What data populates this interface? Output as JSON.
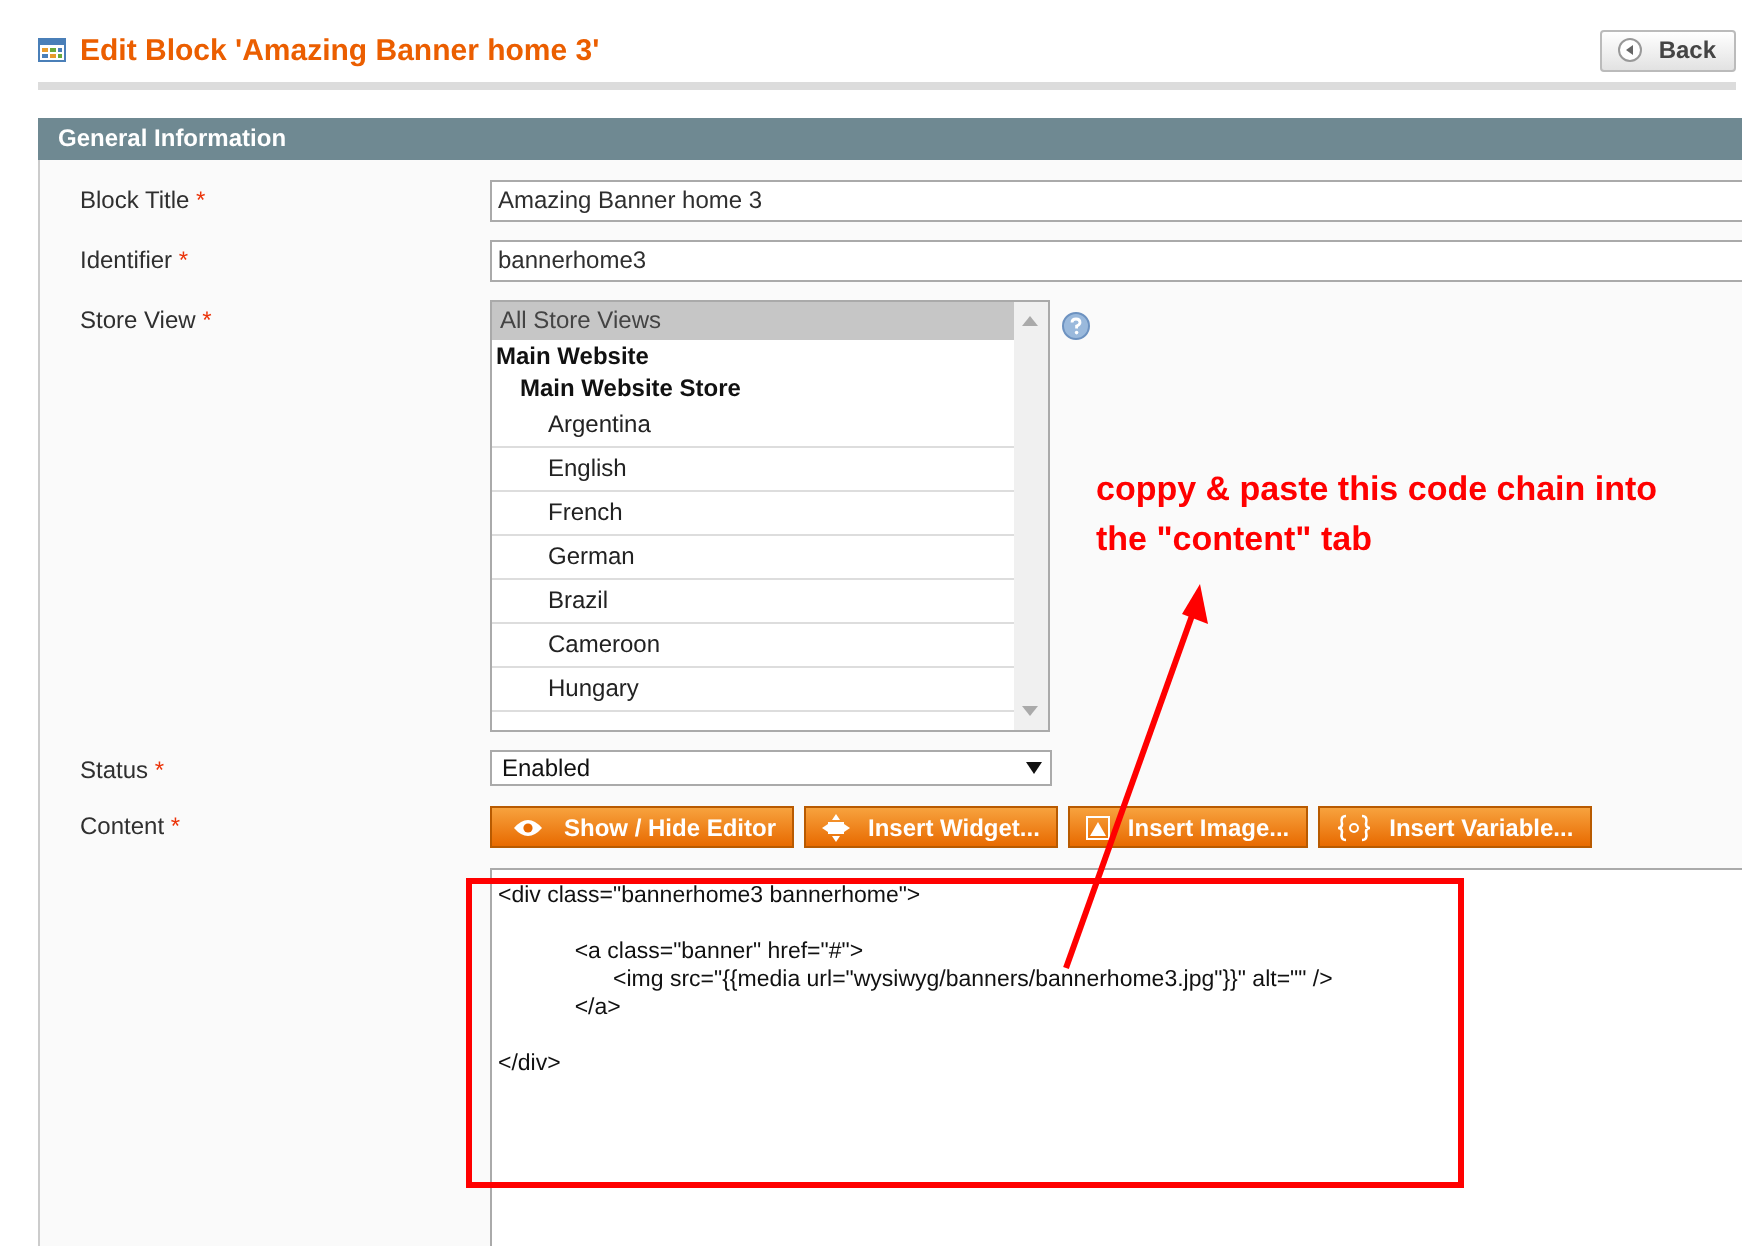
{
  "header": {
    "title": "Edit Block 'Amazing Banner home 3'",
    "back_button": "Back"
  },
  "section": {
    "title": "General Information"
  },
  "fields": [
    {
      "kind": "text",
      "label": "Block Title",
      "required": "*",
      "value": "Amazing Banner home 3"
    },
    {
      "kind": "text",
      "label": "Identifier",
      "required": "*",
      "value": "bannerhome3"
    },
    {
      "kind": "multiselect",
      "label": "Store View",
      "required": "*",
      "options": [
        {
          "kind": "all",
          "label": "All Store Views",
          "selected": true
        },
        {
          "kind": "website",
          "label": "Main Website",
          "selected": false
        },
        {
          "kind": "store",
          "label": "Main Website Store",
          "selected": false
        },
        {
          "kind": "view",
          "label": "Argentina",
          "selected": false
        },
        {
          "kind": "view",
          "label": "English",
          "selected": false
        },
        {
          "kind": "view",
          "label": "French",
          "selected": false
        },
        {
          "kind": "view",
          "label": "German",
          "selected": false
        },
        {
          "kind": "view",
          "label": "Brazil",
          "selected": false
        },
        {
          "kind": "view",
          "label": "Cameroon",
          "selected": false
        },
        {
          "kind": "view",
          "label": "Hungary",
          "selected": false
        }
      ]
    },
    {
      "kind": "select",
      "label": "Status",
      "required": "*",
      "value": "Enabled"
    },
    {
      "kind": "editor",
      "label": "Content",
      "required": "*",
      "buttons": [
        "Show / Hide Editor",
        "Insert Widget...",
        "Insert Image...",
        "Insert Variable..."
      ],
      "value": "<div class=\"bannerhome3 bannerhome\">\n\n\t\t<a class=\"banner\" href=\"#\">\n\t\t\t<img src=\"{{media url=\"wysiwyg/banners/bannerhome3.jpg\"}}\" alt=\"\" />\n\t\t</a>\n\n</div>"
    }
  ],
  "annotation": {
    "text": "coppy & paste this code chain into the \"content\" tab"
  }
}
